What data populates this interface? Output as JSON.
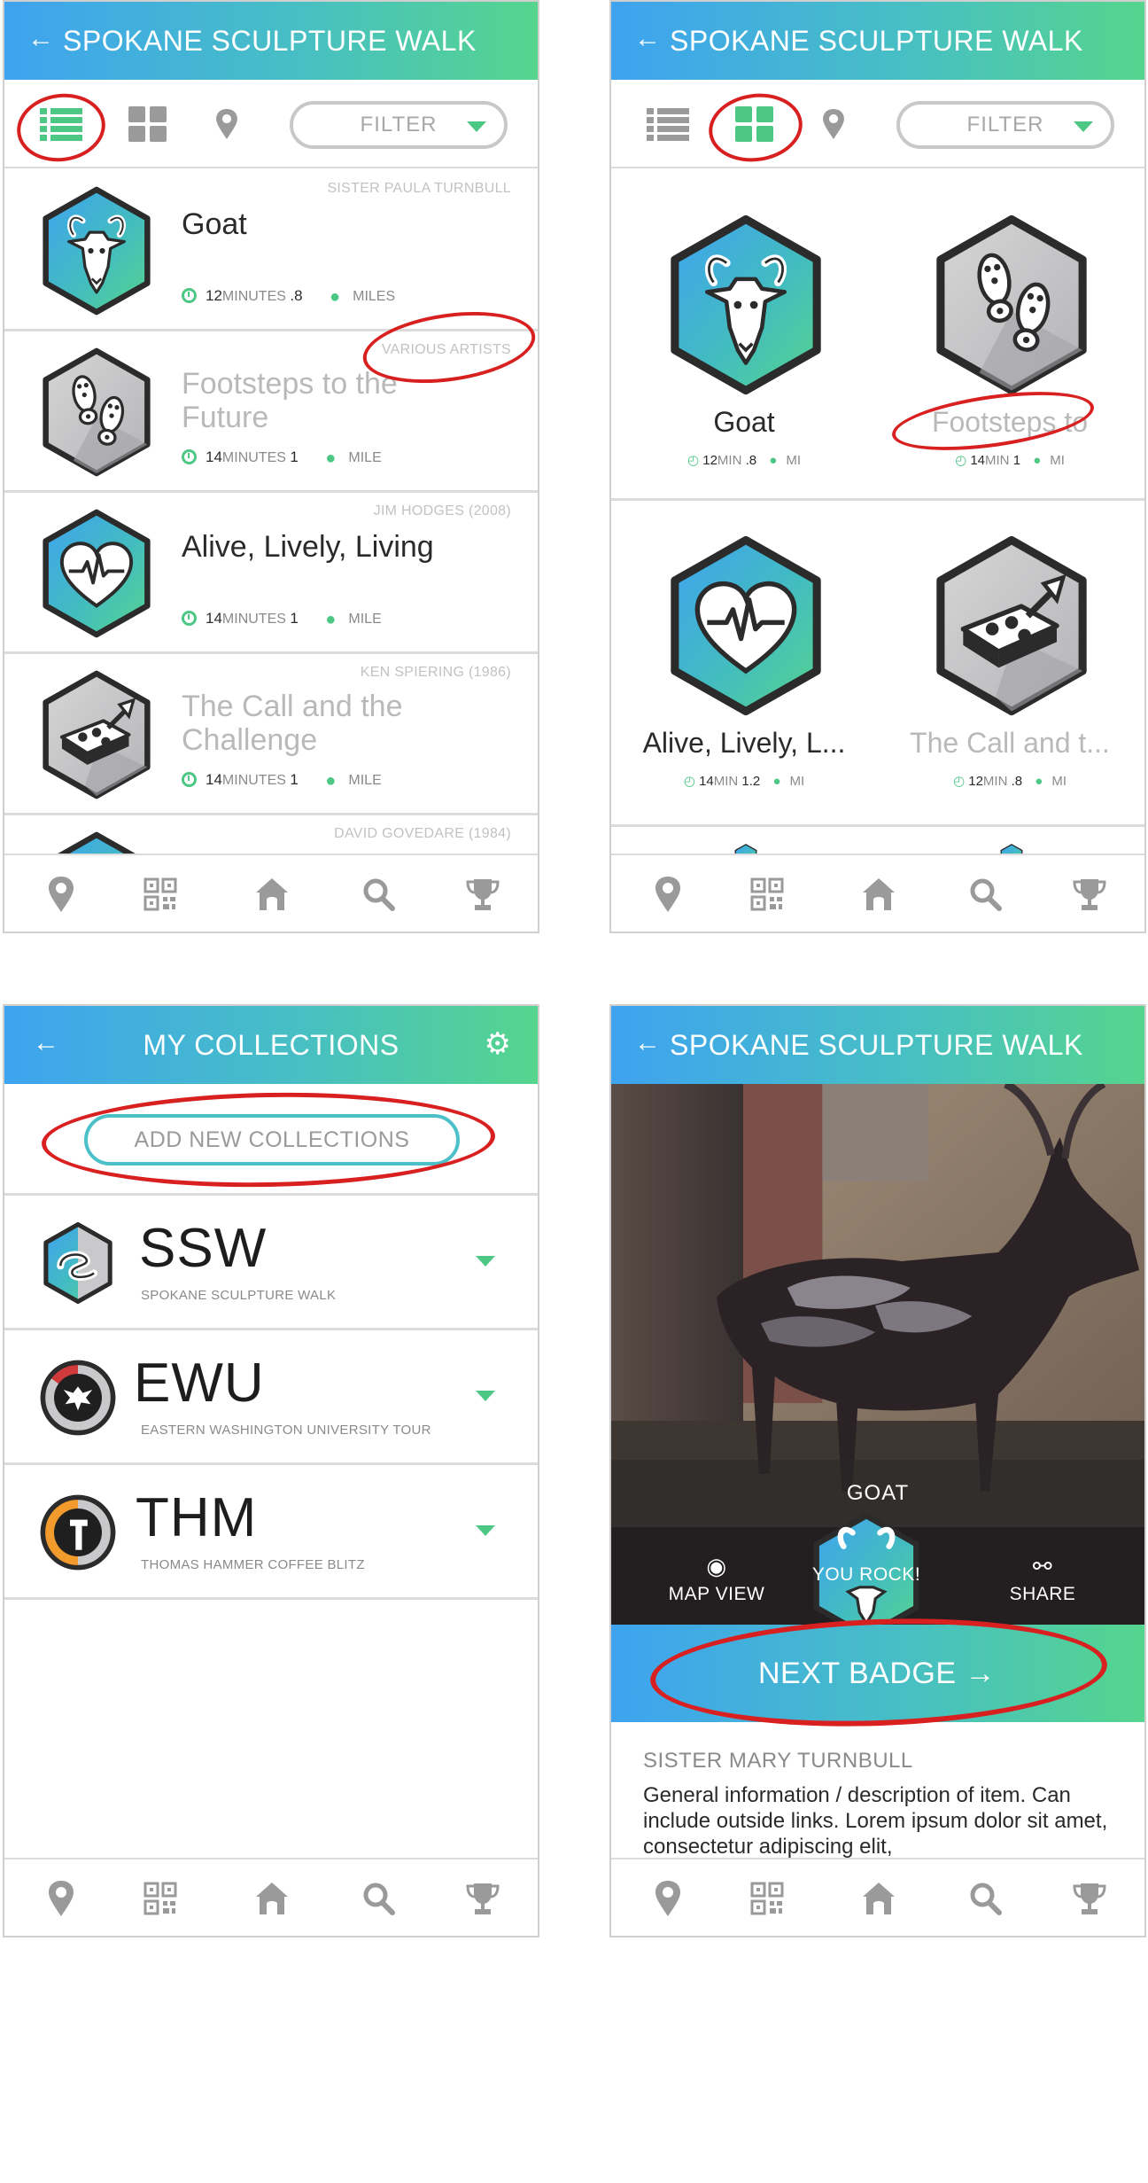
{
  "colors": {
    "accent_green": "#4cc884",
    "accent_blue": "#3ea3f0",
    "annotation_red": "#d82020",
    "icon_gray": "#9a9a9a"
  },
  "screen1": {
    "title": "SPOKANE SCULPTURE WALK",
    "back_icon": "arrow-left-icon",
    "filter_label": "FILTER",
    "items": [
      {
        "artist": "SISTER PAULA TURNBULL",
        "name": "Goat",
        "minutes": "12",
        "minutes_unit": "MINUTES",
        "distance": ".8",
        "distance_unit": "MILES",
        "icon": "goat-icon"
      },
      {
        "artist": "VARIOUS ARTISTS",
        "name": "Footsteps to the Future",
        "minutes": "14",
        "minutes_unit": "MINUTES",
        "distance": "1",
        "distance_unit": "MILE",
        "icon": "footprints-icon"
      },
      {
        "artist": "JIM HODGES (2008)",
        "name": "Alive, Lively, Living",
        "minutes": "14",
        "minutes_unit": "MINUTES",
        "distance": "1",
        "distance_unit": "MILE",
        "icon": "heartbeat-icon"
      },
      {
        "artist": "KEN SPIERING (1986)",
        "name": "The Call and the Challenge",
        "minutes": "14",
        "minutes_unit": "MINUTES",
        "distance": "1",
        "distance_unit": "MILE",
        "icon": "brick-trowel-icon"
      },
      {
        "artist": "DAVID GOVEDARE (1984)"
      }
    ]
  },
  "screen2": {
    "title": "SPOKANE SCULPTURE WALK",
    "filter_label": "FILTER",
    "items": [
      {
        "name": "Goat",
        "minutes": "12",
        "min_unit": "MIN",
        "distance": ".8",
        "dist_unit": "MI"
      },
      {
        "name": "Footsteps to",
        "minutes": "14",
        "min_unit": "MIN",
        "distance": "1",
        "dist_unit": "MI"
      },
      {
        "name": "Alive, Lively, L...",
        "minutes": "14",
        "min_unit": "MIN",
        "distance": "1.2",
        "dist_unit": "MI"
      },
      {
        "name": "The Call and t...",
        "minutes": "12",
        "min_unit": "MIN",
        "distance": ".8",
        "dist_unit": "MI"
      }
    ]
  },
  "screen3": {
    "title": "MY COLLECTIONS",
    "add_button": "ADD NEW COLLECTIONS",
    "collections": [
      {
        "abbr": "SSW",
        "name": "SPOKANE SCULPTURE WALK"
      },
      {
        "abbr": "EWU",
        "name": "EASTERN WASHINGTON UNIVERSITY TOUR"
      },
      {
        "abbr": "THM",
        "name": "THOMAS HAMMER COFFEE BLITZ"
      }
    ]
  },
  "screen4": {
    "title": "SPOKANE SCULPTURE WALK",
    "caption": "GOAT",
    "map_view": "MAP VIEW",
    "badge_text": "YOU ROCK!",
    "share": "SHARE",
    "next_badge": "NEXT BADGE",
    "artist": "SISTER MARY TURNBULL",
    "description": "General information / description of item. Can include outside links. Lorem ipsum dolor sit amet, consectetur adipiscing elit,"
  },
  "navbar": [
    "map-pin-icon",
    "qr-code-icon",
    "home-icon",
    "search-icon",
    "trophy-icon"
  ]
}
